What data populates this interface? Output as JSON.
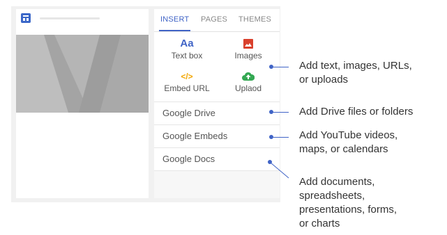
{
  "tabs": [
    {
      "label": "INSERT",
      "active": true
    },
    {
      "label": "PAGES",
      "active": false
    },
    {
      "label": "THEMES",
      "active": false
    }
  ],
  "tools": [
    {
      "label": "Text box",
      "icon": "text-aa-icon",
      "glyph": "Aa",
      "color": "#3f63c6"
    },
    {
      "label": "Images",
      "icon": "image-icon",
      "color": "#d9402c"
    },
    {
      "label": "Embed URL",
      "icon": "code-icon",
      "glyph": "</>",
      "color": "#f2a600"
    },
    {
      "label": "Uplaod",
      "icon": "cloud-upload-icon",
      "color": "#34a853"
    }
  ],
  "sections": [
    {
      "label": "Google Drive"
    },
    {
      "label": "Google Embeds"
    },
    {
      "label": "Google Docs"
    }
  ],
  "callouts": [
    {
      "lines": [
        "Add text, images, URLs,",
        "or uploads"
      ]
    },
    {
      "lines": [
        "Add Drive files or folders"
      ]
    },
    {
      "lines": [
        "Add YouTube videos,",
        "maps, or calendars"
      ]
    },
    {
      "lines": [
        "Add documents,",
        "spreadsheets,",
        "presentations, forms,",
        "or charts"
      ]
    }
  ],
  "colors": {
    "accent": "#3f63c6",
    "panel_bg": "#f7f7f7",
    "frame_bg": "#f1f1f1"
  }
}
